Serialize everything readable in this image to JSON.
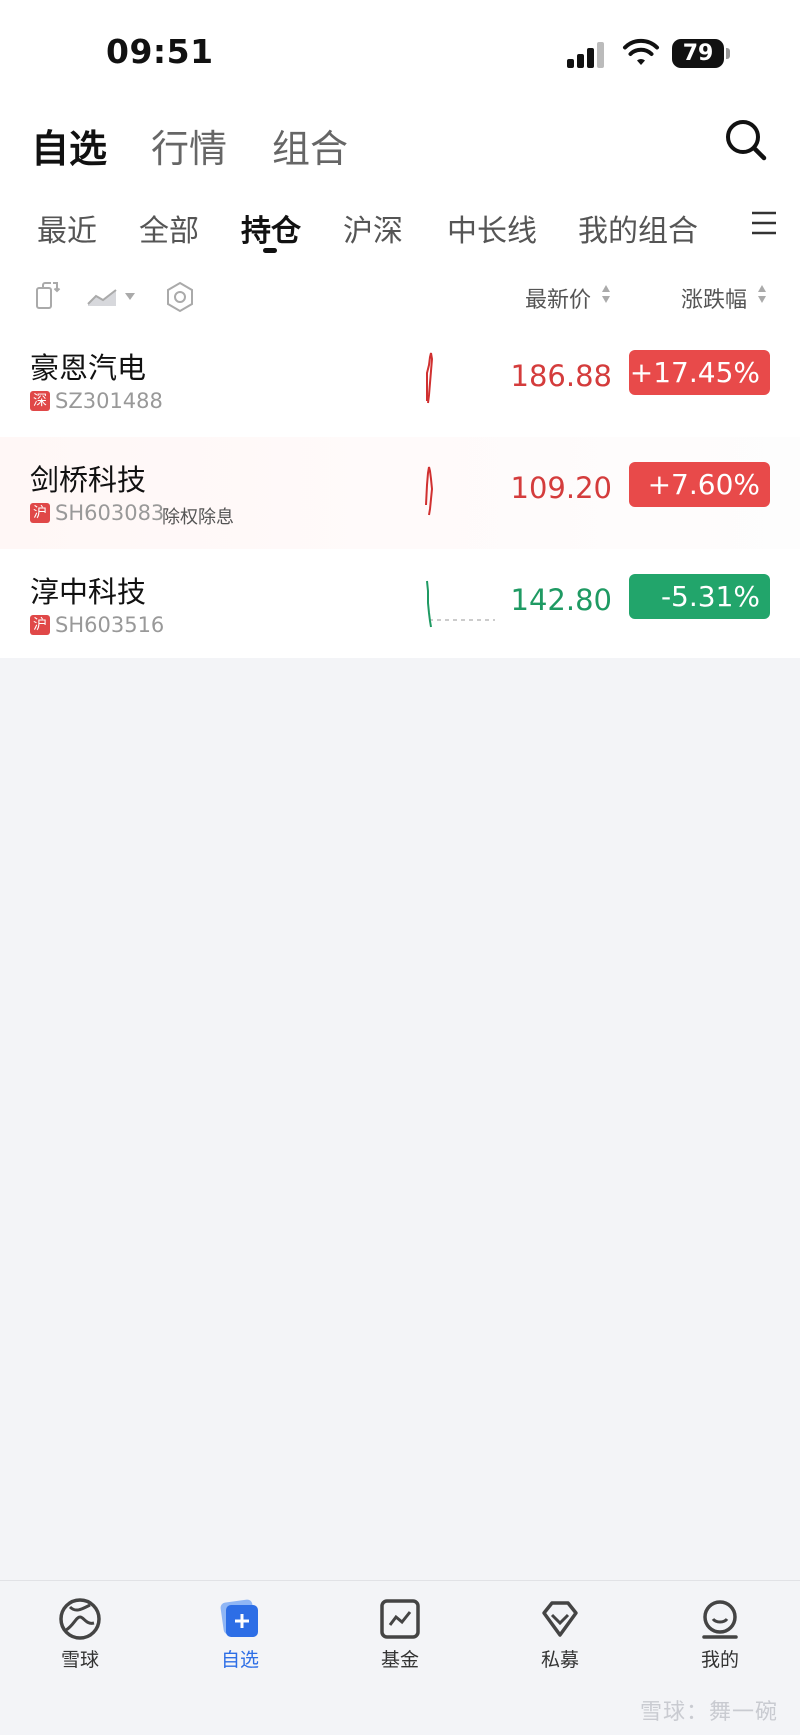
{
  "status_bar": {
    "time": "09:51",
    "battery": "79"
  },
  "main_tabs": [
    "自选",
    "行情",
    "组合"
  ],
  "sub_tabs": [
    "最近",
    "全部",
    "持仓",
    "沪深",
    "中长线",
    "我的组合"
  ],
  "columns": {
    "price": "最新价",
    "change": "涨跌幅"
  },
  "stocks": [
    {
      "name": "豪恩汽电",
      "exchange": "深",
      "code": "SZ301488",
      "tag": "",
      "price": "186.88",
      "change": "+17.45%"
    },
    {
      "name": "剑桥科技",
      "exchange": "沪",
      "code": "SH603083",
      "tag": "除权除息",
      "price": "109.20",
      "change": "+7.60%"
    },
    {
      "name": "淳中科技",
      "exchange": "沪",
      "code": "SH603516",
      "tag": "",
      "price": "142.80",
      "change": "-5.31%"
    }
  ],
  "bottom_nav": [
    "雪球",
    "自选",
    "基金",
    "私募",
    "我的"
  ],
  "watermark": "雪球：舞一碗",
  "colors": {
    "up": "#e84a4a",
    "up_text": "#d43c3c",
    "down": "#22a56b",
    "down_text": "#1f9a63",
    "accent": "#2d6ee6"
  }
}
